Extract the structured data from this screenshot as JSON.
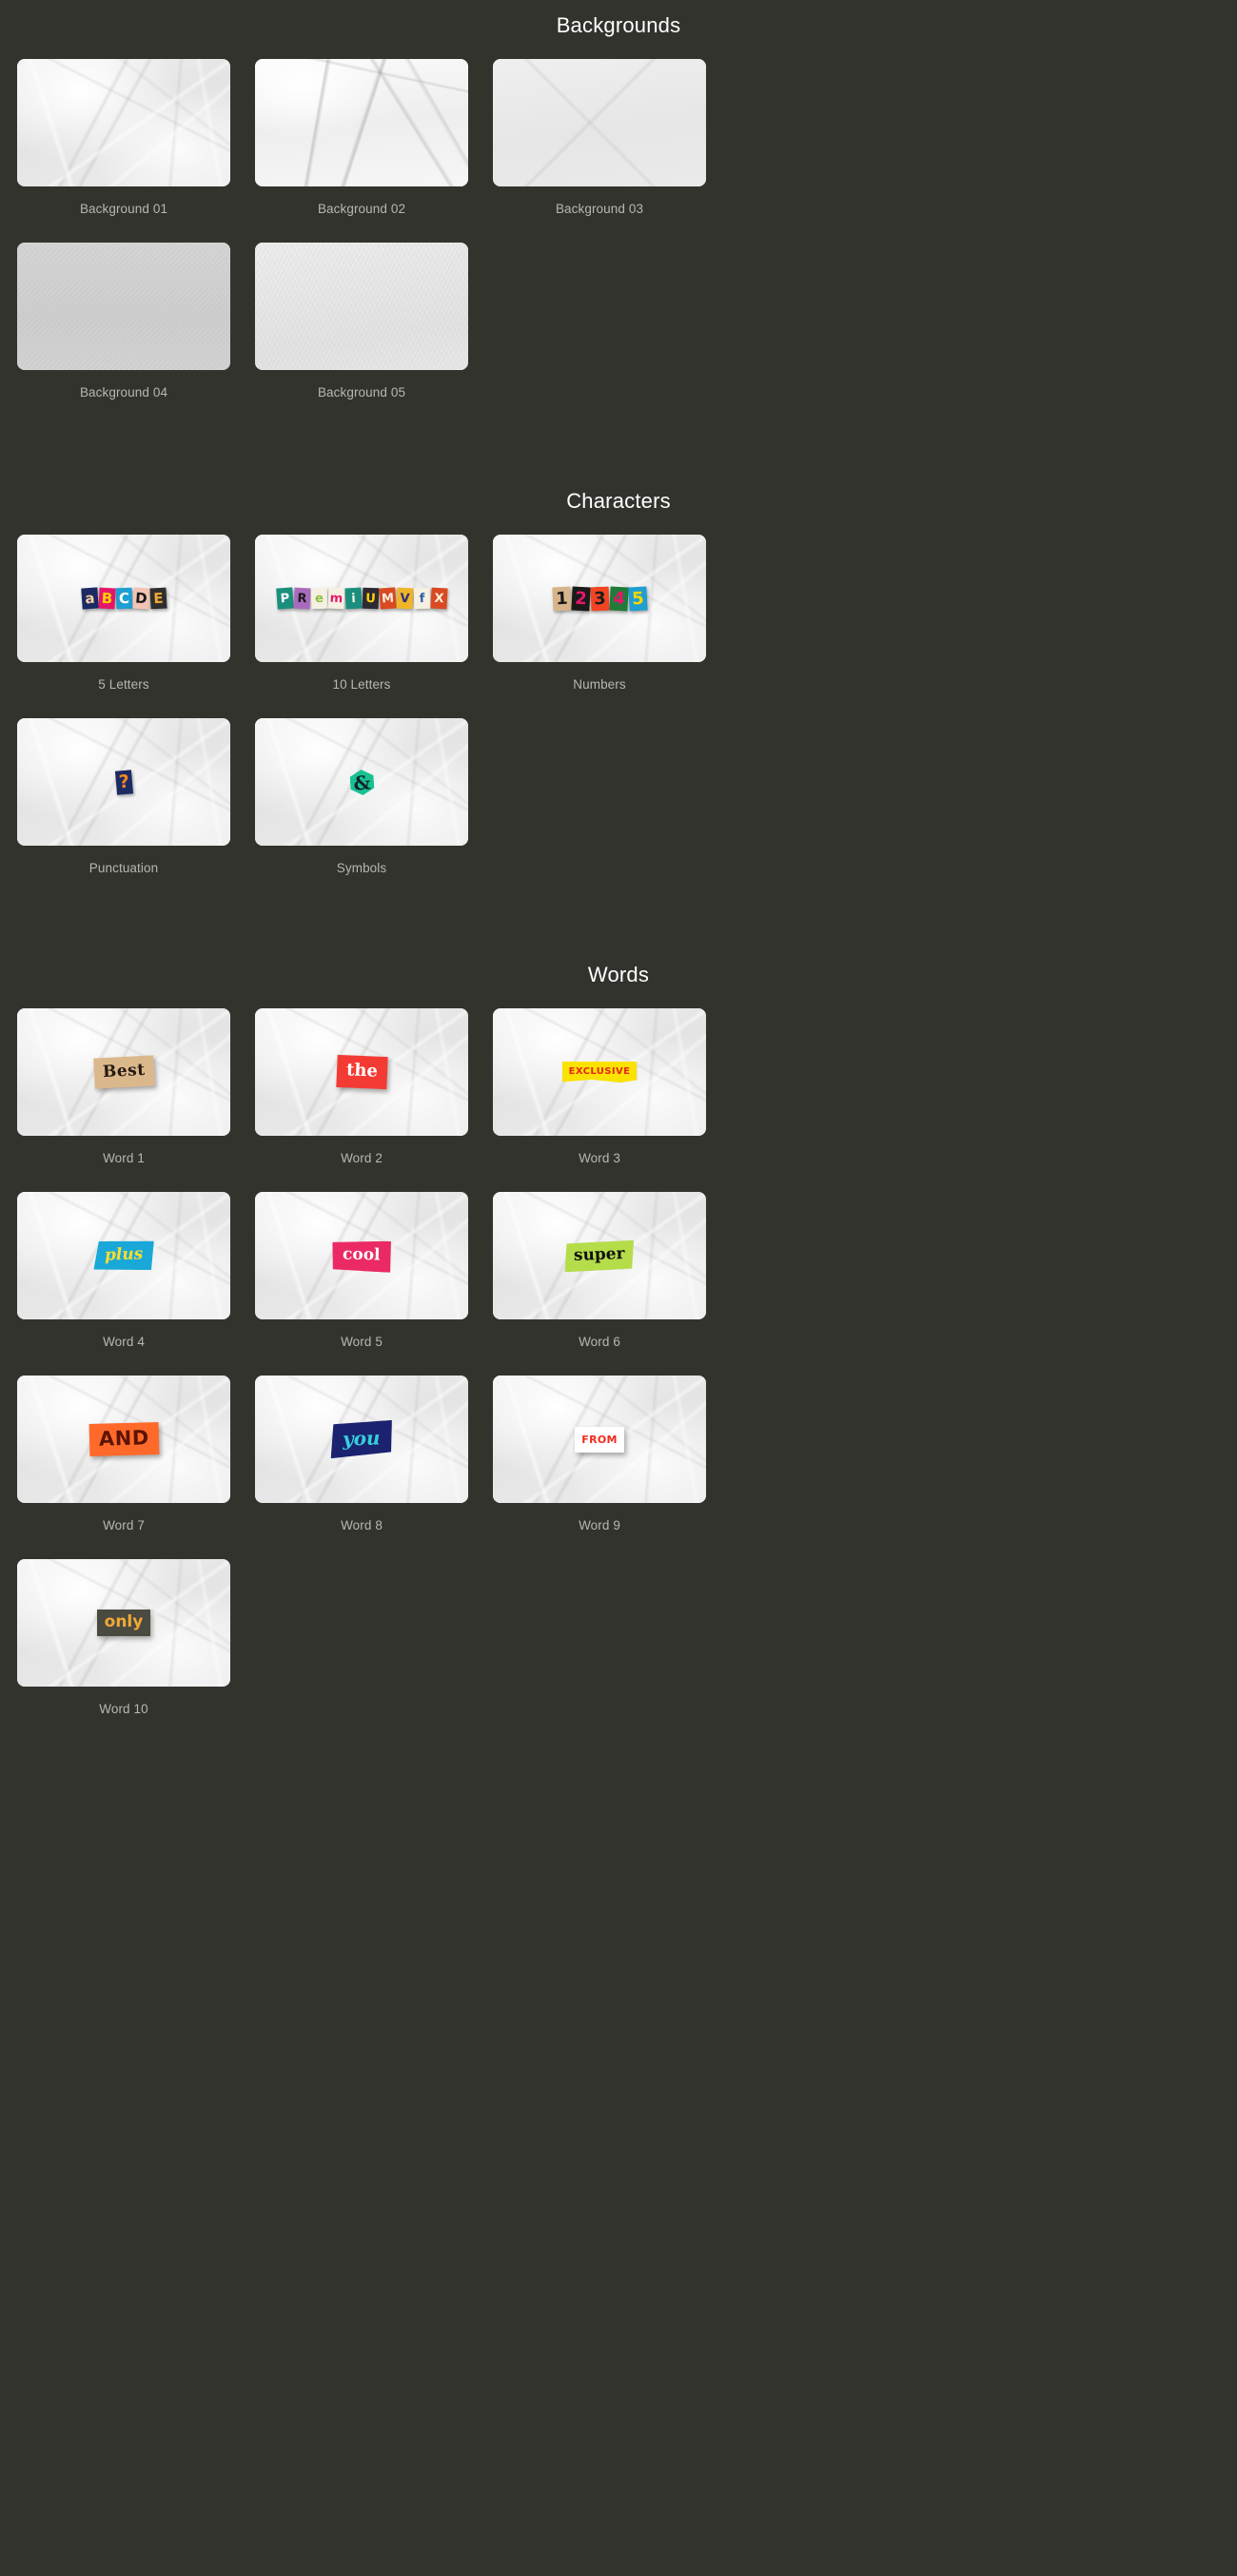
{
  "theme": {
    "page_bg": "#33332e",
    "caption_color": "#b6b6b2",
    "title_color": "#ffffff"
  },
  "sections": [
    {
      "id": "backgrounds",
      "title": "Backgrounds",
      "items": [
        {
          "caption": "Background 01",
          "texture": "paper-crumple"
        },
        {
          "caption": "Background 02",
          "texture": "paper-torn"
        },
        {
          "caption": "Background 03",
          "texture": "paper-smooth"
        },
        {
          "caption": "Background 04",
          "texture": "paper-grain"
        },
        {
          "caption": "Background 05",
          "texture": "paper-fiber"
        }
      ]
    },
    {
      "id": "characters",
      "title": "Characters",
      "items": [
        {
          "caption": "5 Letters",
          "texture": "paper-crumple",
          "tiles": [
            {
              "char": "a",
              "bg": "#1c2a63",
              "fg": "#f5cfa2",
              "rot": -4
            },
            {
              "char": "B",
              "bg": "#e6176b",
              "fg": "#ffd400",
              "rot": 3
            },
            {
              "char": "C",
              "bg": "#1f9fd1",
              "fg": "#ffffff",
              "rot": -2
            },
            {
              "char": "D",
              "bg": "#f3c3b4",
              "fg": "#1a1a1a",
              "rot": 4
            },
            {
              "char": "E",
              "bg": "#2e2e2e",
              "fg": "#f0a937",
              "rot": -3
            }
          ]
        },
        {
          "caption": "10 Letters",
          "texture": "paper-crumple",
          "tiles": [
            {
              "char": "P",
              "bg": "#1b8f7e",
              "fg": "#ffffff",
              "rot": -4
            },
            {
              "char": "R",
              "bg": "#a96bbd",
              "fg": "#1a1a1a",
              "rot": 3
            },
            {
              "char": "e",
              "bg": "#f5f0e1",
              "fg": "#8dbf3f",
              "rot": -2
            },
            {
              "char": "m",
              "bg": "#f5f0e1",
              "fg": "#e6176b",
              "rot": 3
            },
            {
              "char": "i",
              "bg": "#1b8f7e",
              "fg": "#f5f0e1",
              "rot": -3
            },
            {
              "char": "U",
              "bg": "#2e2a33",
              "fg": "#ffd400",
              "rot": 2
            },
            {
              "char": "M",
              "bg": "#d94a20",
              "fg": "#f5f0e1",
              "rot": -4
            },
            {
              "char": "V",
              "bg": "#f0b429",
              "fg": "#2b2f7a",
              "rot": 3
            },
            {
              "char": "f",
              "bg": "#f5f0e1",
              "fg": "#2b5fa8",
              "rot": -2
            },
            {
              "char": "X",
              "bg": "#d94a20",
              "fg": "#f5f0e1",
              "rot": 3
            }
          ]
        },
        {
          "caption": "Numbers",
          "texture": "paper-crumple",
          "tiles": [
            {
              "char": "1",
              "bg": "#d8b48a",
              "fg": "#1a1a1a",
              "rot": -3
            },
            {
              "char": "2",
              "bg": "#1a1a1a",
              "fg": "#e6176b",
              "rot": 3
            },
            {
              "char": "3",
              "bg": "#f24423",
              "fg": "#1a1a1a",
              "rot": -2
            },
            {
              "char": "4",
              "bg": "#237a3a",
              "fg": "#e6176b",
              "rot": 3
            },
            {
              "char": "5",
              "bg": "#1f9fd1",
              "fg": "#ffd400",
              "rot": -3
            }
          ]
        },
        {
          "caption": "Punctuation",
          "texture": "paper-crumple",
          "tiles": [
            {
              "char": "?",
              "bg": "#1c2a63",
              "fg": "#f0881f",
              "rot": -5,
              "solo": true
            }
          ]
        },
        {
          "caption": "Symbols",
          "texture": "paper-crumple",
          "tiles": [
            {
              "char": "&",
              "bg": "#19c191",
              "fg": "#12222b",
              "rot": -4,
              "hex": true
            }
          ]
        }
      ]
    },
    {
      "id": "words",
      "title": "Words",
      "items": [
        {
          "caption": "Word 1",
          "texture": "paper-crumple",
          "word": "Best",
          "chip": "chip-best",
          "bg": "#dbb88c",
          "fg": "#241a12"
        },
        {
          "caption": "Word 2",
          "texture": "paper-crumple",
          "word": "the",
          "chip": "chip-the",
          "bg": "#f33b34",
          "fg": "#ffffff"
        },
        {
          "caption": "Word 3",
          "texture": "paper-crumple",
          "word": "EXCLUSIVE",
          "chip": "chip-exclusive",
          "bg": "#fbe200",
          "fg": "#e8271c"
        },
        {
          "caption": "Word 4",
          "texture": "paper-crumple",
          "word": "plus",
          "chip": "chip-plus",
          "bg": "#19a8d8",
          "fg": "#ffdd2e"
        },
        {
          "caption": "Word 5",
          "texture": "paper-crumple",
          "word": "cool",
          "chip": "chip-cool",
          "bg": "#eb2a65",
          "fg": "#ffffff"
        },
        {
          "caption": "Word 6",
          "texture": "paper-crumple",
          "word": "super",
          "chip": "chip-super",
          "bg": "#b5dd4a",
          "fg": "#111111"
        },
        {
          "caption": "Word 7",
          "texture": "paper-crumple",
          "word": "AND",
          "chip": "chip-and",
          "bg": "#ff6a2b",
          "fg": "#5d1405"
        },
        {
          "caption": "Word 8",
          "texture": "paper-crumple",
          "word": "you",
          "chip": "chip-you",
          "bg": "#1b2270",
          "fg": "#35d0db"
        },
        {
          "caption": "Word 9",
          "texture": "paper-crumple",
          "word": "FROM",
          "chip": "chip-from",
          "bg": "#ffffff",
          "fg": "#ef2b1b"
        },
        {
          "caption": "Word 10",
          "texture": "paper-crumple",
          "word": "only",
          "chip": "chip-only",
          "bg": "#4a4a40",
          "fg": "#f0a937"
        }
      ]
    }
  ]
}
